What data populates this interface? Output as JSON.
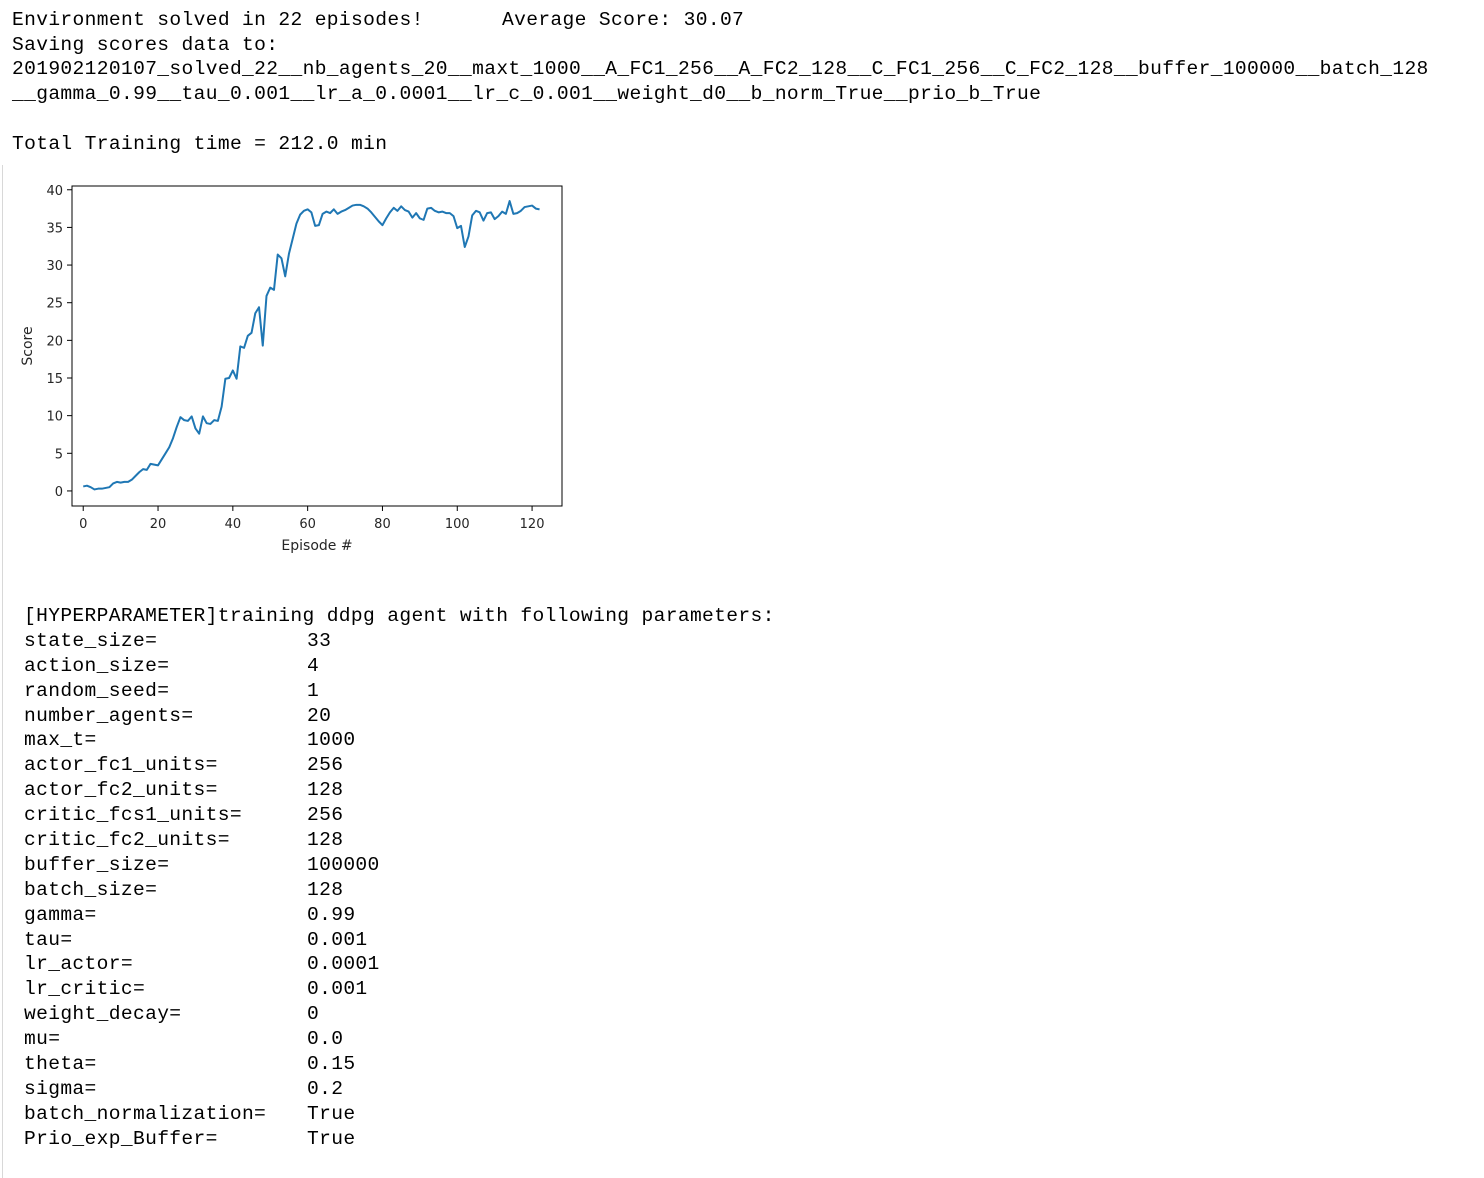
{
  "output": {
    "line1_left": "Environment solved in 22 episodes!",
    "line1_right": "Average Score: 30.07",
    "line2": "Saving scores data to:",
    "line3": "201902120107_solved_22__nb_agents_20__maxt_1000__A_FC1_256__A_FC2_128__C_FC1_256__C_FC2_128__buffer_100000__batch_128",
    "line4": "__gamma_0.99__tau_0.001__lr_a_0.0001__lr_c_0.001__weight_d0__b_norm_True__prio_b_True",
    "training_time": "Total Training time = 212.0 min"
  },
  "chart_data": {
    "type": "line",
    "title": "",
    "xlabel": "Episode #",
    "ylabel": "Score",
    "xlim": [
      -3,
      128
    ],
    "ylim": [
      -2,
      40.5
    ],
    "xticks": [
      0,
      20,
      40,
      60,
      80,
      100,
      120
    ],
    "yticks": [
      0,
      5,
      10,
      15,
      20,
      25,
      30,
      35,
      40
    ],
    "line_color": "#1f77b4",
    "grid": false,
    "series": [
      {
        "x": [
          0,
          1,
          2,
          3,
          4,
          5,
          6,
          7,
          8,
          9,
          10,
          11,
          12,
          13,
          14,
          15,
          16,
          17,
          18,
          19,
          20,
          21,
          22,
          23,
          24,
          25,
          26,
          27,
          28,
          29,
          30,
          31,
          32,
          33,
          34,
          35,
          36,
          37,
          38,
          39,
          40,
          41,
          42,
          43,
          44,
          45,
          46,
          47,
          48,
          49,
          50,
          51,
          52,
          53,
          54,
          55,
          56,
          57,
          58,
          59,
          60,
          61,
          62,
          63,
          64,
          65,
          66,
          67,
          68,
          69,
          70,
          71,
          72,
          73,
          74,
          75,
          76,
          77,
          78,
          79,
          80,
          81,
          82,
          83,
          84,
          85,
          86,
          87,
          88,
          89,
          90,
          91,
          92,
          93,
          94,
          95,
          96,
          97,
          98,
          99,
          100,
          101,
          102,
          103,
          104,
          105,
          106,
          107,
          108,
          109,
          110,
          111,
          112,
          113,
          114,
          115,
          116,
          117,
          118,
          119,
          120,
          121,
          122
        ],
        "y": [
          0.6,
          0.7,
          0.5,
          0.2,
          0.3,
          0.3,
          0.4,
          0.5,
          1.0,
          1.2,
          1.1,
          1.2,
          1.2,
          1.5,
          2.0,
          2.5,
          2.9,
          2.8,
          3.6,
          3.5,
          3.4,
          4.2,
          5.0,
          5.8,
          7.0,
          8.5,
          9.8,
          9.4,
          9.3,
          9.9,
          8.3,
          7.6,
          9.9,
          9.0,
          8.9,
          9.4,
          9.3,
          11.2,
          14.9,
          15.0,
          16.0,
          14.9,
          19.2,
          19.0,
          20.6,
          21.0,
          23.6,
          24.4,
          19.3,
          25.9,
          27.0,
          26.7,
          31.4,
          30.9,
          28.5,
          31.5,
          33.5,
          35.5,
          36.7,
          37.2,
          37.4,
          37.0,
          35.2,
          35.3,
          36.8,
          37.1,
          36.9,
          37.4,
          36.8,
          37.1,
          37.3,
          37.6,
          37.9,
          38.0,
          38.0,
          37.8,
          37.5,
          37.0,
          36.4,
          35.8,
          35.3,
          36.2,
          37.0,
          37.6,
          37.2,
          37.8,
          37.3,
          37.1,
          36.3,
          36.9,
          36.2,
          36.0,
          37.5,
          37.6,
          37.2,
          37.0,
          37.1,
          36.9,
          36.9,
          36.5,
          34.9,
          35.2,
          32.4,
          33.8,
          36.6,
          37.2,
          37.0,
          35.9,
          36.9,
          37.0,
          36.1,
          36.5,
          37.1,
          36.8,
          38.5,
          36.8,
          36.9,
          37.2,
          37.7,
          37.8,
          37.9,
          37.5,
          37.4
        ]
      }
    ]
  },
  "hyperparams": {
    "header": "[HYPERPARAMETER]training ddpg agent with following parameters:",
    "rows": [
      {
        "key": "state_size=",
        "value": "33"
      },
      {
        "key": "action_size=",
        "value": "4"
      },
      {
        "key": "random_seed=",
        "value": "1"
      },
      {
        "key": "number_agents=",
        "value": "20"
      },
      {
        "key": "max_t=",
        "value": "1000"
      },
      {
        "key": "actor_fc1_units=",
        "value": "256"
      },
      {
        "key": "actor_fc2_units=",
        "value": "128"
      },
      {
        "key": "critic_fcs1_units=",
        "value": "256"
      },
      {
        "key": "critic_fc2_units=",
        "value": "128"
      },
      {
        "key": "buffer_size=",
        "value": "100000"
      },
      {
        "key": "batch_size=",
        "value": "128"
      },
      {
        "key": "gamma=",
        "value": "0.99"
      },
      {
        "key": "tau=",
        "value": "0.001"
      },
      {
        "key": "lr_actor=",
        "value": "0.0001"
      },
      {
        "key": "lr_critic=",
        "value": "0.001"
      },
      {
        "key": "weight_decay=",
        "value": "0"
      },
      {
        "key": "mu=",
        "value": "0.0"
      },
      {
        "key": "theta=",
        "value": "0.15"
      },
      {
        "key": "sigma=",
        "value": "0.2"
      },
      {
        "key": "batch_normalization=",
        "value": "True"
      },
      {
        "key": "Prio_exp_Buffer=",
        "value": "True"
      }
    ]
  }
}
